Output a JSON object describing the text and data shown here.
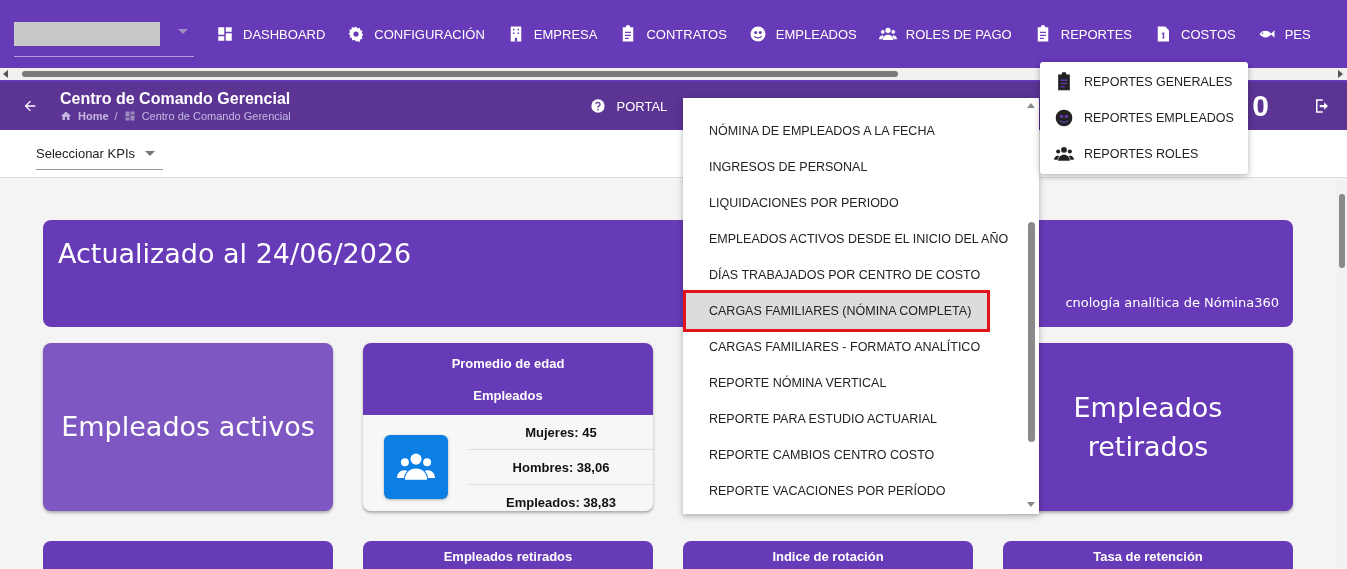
{
  "top_nav": {
    "items": [
      {
        "label": "DASHBOARD"
      },
      {
        "label": "CONFIGURACIÓN"
      },
      {
        "label": "EMPRESA"
      },
      {
        "label": "CONTRATOS"
      },
      {
        "label": "EMPLEADOS"
      },
      {
        "label": "ROLES DE PAGO"
      },
      {
        "label": "REPORTES"
      },
      {
        "label": "COSTOS"
      },
      {
        "label": "PES"
      }
    ]
  },
  "subheader": {
    "title": "Centro de Comando Gerencial",
    "breadcrumb": [
      "Home",
      "Centro de Comando Gerencial"
    ],
    "breadcrumb_separator": "/",
    "portal_label": "PORTAL",
    "stat_value": "0"
  },
  "toolbar": {
    "kpi_select": {
      "value": "Seleccionar KPIs"
    }
  },
  "banner": {
    "title": "Actualizado al 24/06/2026",
    "subtitle": "cnología analítica de Nómina360"
  },
  "cards": [
    {
      "kind": "title",
      "title": "Empleados activos"
    },
    {
      "kind": "stats",
      "title": "Promedio de edad",
      "subtitle": "Empleados",
      "rows": [
        "Mujeres: 45",
        "Hombres: 38,06",
        "Empleados: 38,83"
      ]
    },
    {
      "kind": "title",
      "title": "Empleados retirados"
    }
  ],
  "bottom_cards": [
    {
      "kind": "blank"
    },
    {
      "kind": "header",
      "title": "Empleados retirados"
    },
    {
      "kind": "header",
      "title": "Indice de rotación"
    },
    {
      "kind": "header",
      "title": "Tasa de retención"
    }
  ],
  "report_list": {
    "items": [
      {
        "label": "NÓMINA DE EMPLEADOS A LA FECHA",
        "selected": false
      },
      {
        "label": "INGRESOS DE PERSONAL",
        "selected": false
      },
      {
        "label": "LIQUIDACIONES POR PERIODO",
        "selected": false
      },
      {
        "label": "EMPLEADOS ACTIVOS DESDE EL INICIO DEL AÑO",
        "selected": false
      },
      {
        "label": "DÍAS TRABAJADOS POR CENTRO DE COSTO",
        "selected": false
      },
      {
        "label": "CARGAS FAMILIARES (NÓMINA COMPLETA)",
        "selected": true
      },
      {
        "label": "CARGAS FAMILIARES - FORMATO ANALÍTICO",
        "selected": false
      },
      {
        "label": "REPORTE NÓMINA VERTICAL",
        "selected": false
      },
      {
        "label": "REPORTE PARA ESTUDIO ACTUARIAL",
        "selected": false
      },
      {
        "label": "REPORTE CAMBIOS CENTRO COSTO",
        "selected": false
      },
      {
        "label": "REPORTE VACACIONES POR PERÍODO",
        "selected": false
      }
    ]
  },
  "reports_menu": {
    "items": [
      {
        "label": "REPORTES GENERALES"
      },
      {
        "label": "REPORTES EMPLEADOS"
      },
      {
        "label": "REPORTES ROLES"
      }
    ]
  }
}
